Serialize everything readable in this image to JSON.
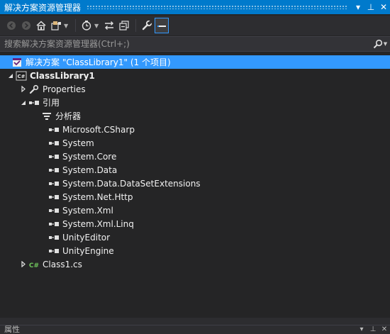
{
  "window": {
    "title": "解决方案资源管理器",
    "buttons": [
      "▾",
      "⊥",
      "✕"
    ]
  },
  "toolbar": {
    "icons": [
      "back-icon",
      "forward-icon",
      "home-icon",
      "switch-views-icon",
      "pending-changes-filter-icon",
      "sync-with-document-icon",
      "collapse-all-icon",
      "properties-icon",
      "preview-selected-items-icon"
    ]
  },
  "search": {
    "placeholder": "搜索解决方案资源管理器(Ctrl+;)"
  },
  "tree": {
    "solution_label": "解决方案 \"ClassLibrary1\" (1 个项目)",
    "project_label": "ClassLibrary1",
    "properties_label": "Properties",
    "references_label": "引用",
    "references": [
      "分析器",
      "Microsoft.CSharp",
      "System",
      "System.Core",
      "System.Data",
      "System.Data.DataSetExtensions",
      "System.Net.Http",
      "System.Xml",
      "System.Xml.Linq",
      "UnityEditor",
      "UnityEngine"
    ],
    "class_file_label": "Class1.cs"
  },
  "bottom_panel": {
    "title": "属性",
    "buttons": [
      "▾",
      "⊥",
      "✕"
    ]
  },
  "colors": {
    "title_bar": "#007acc",
    "selection": "#3399ff",
    "background": "#252526",
    "toolbar": "#2d2d30"
  }
}
